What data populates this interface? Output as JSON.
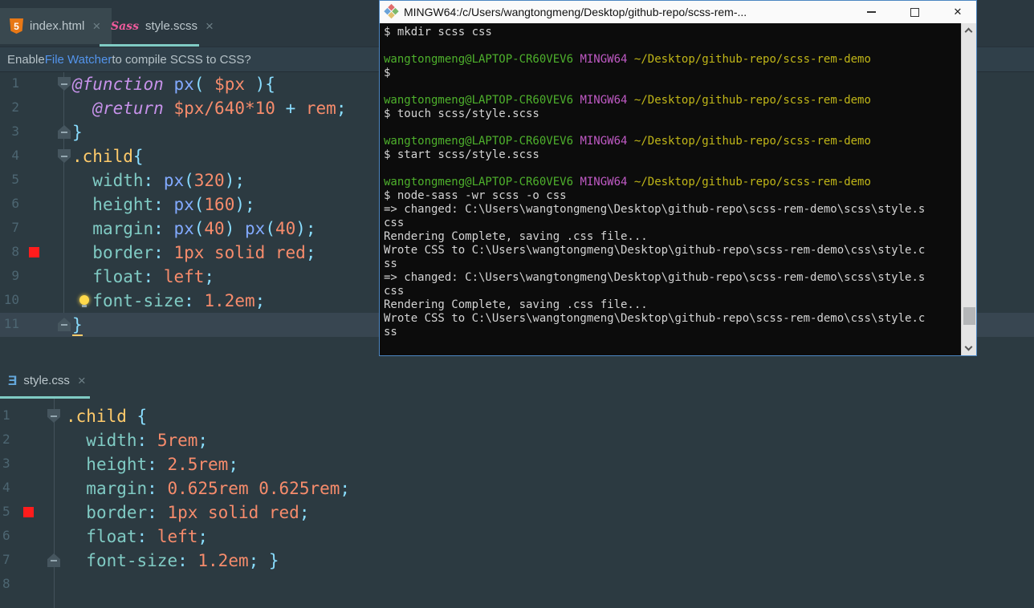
{
  "ui": {
    "tabs_top": [
      {
        "label": "index.html"
      },
      {
        "label": "style.scss"
      }
    ],
    "tab_bottom": {
      "label": "style.css"
    },
    "notification": {
      "prefix": "Enable ",
      "link_label": "File Watcher",
      "suffix": " to compile SCSS to CSS?"
    }
  },
  "icons": {
    "close_tab": "×",
    "close_window": "✕",
    "html5_badge": "5",
    "sass_logo": "Sass",
    "css3_glyph": "Ǝ"
  },
  "palette": {
    "kw": "#c792ea",
    "fn": "#82aaff",
    "punc": "#89ddff",
    "num": "#f78c6c",
    "prop": "#80cbc4",
    "sel": "#ffcb6b",
    "plain": "#b0bec5",
    "swatch_red": "#ff1c1c",
    "accent_teal": "#80cbc4",
    "link_blue": "#5394ec"
  },
  "editor_top": {
    "lines": [
      {
        "n": 1,
        "fold": "down",
        "t": [
          [
            "kw",
            "@function"
          ],
          [
            "plain",
            " "
          ],
          [
            "fn",
            "px"
          ],
          [
            "punc",
            "("
          ],
          [
            "plain",
            " "
          ],
          [
            "num",
            "$px"
          ],
          [
            "plain",
            " "
          ],
          [
            "punc",
            "){"
          ]
        ]
      },
      {
        "n": 2,
        "t": [
          [
            "plain",
            "  "
          ],
          [
            "kw",
            "@return"
          ],
          [
            "plain",
            " "
          ],
          [
            "num",
            "$px/640*10"
          ],
          [
            "plain",
            " "
          ],
          [
            "punc",
            "+"
          ],
          [
            "plain",
            " "
          ],
          [
            "num",
            "rem"
          ],
          [
            "punc",
            ";"
          ]
        ]
      },
      {
        "n": 3,
        "fold": "up",
        "t": [
          [
            "punc",
            "}"
          ]
        ]
      },
      {
        "n": 4,
        "fold": "down",
        "t": [
          [
            "sel",
            ".child"
          ],
          [
            "punc",
            "{"
          ]
        ]
      },
      {
        "n": 5,
        "t": [
          [
            "plain",
            "  "
          ],
          [
            "prop",
            "width"
          ],
          [
            "punc",
            ": "
          ],
          [
            "fn",
            "px"
          ],
          [
            "punc",
            "("
          ],
          [
            "num",
            "320"
          ],
          [
            "punc",
            ");"
          ]
        ]
      },
      {
        "n": 6,
        "t": [
          [
            "plain",
            "  "
          ],
          [
            "prop",
            "height"
          ],
          [
            "punc",
            ": "
          ],
          [
            "fn",
            "px"
          ],
          [
            "punc",
            "("
          ],
          [
            "num",
            "160"
          ],
          [
            "punc",
            ");"
          ]
        ]
      },
      {
        "n": 7,
        "t": [
          [
            "plain",
            "  "
          ],
          [
            "prop",
            "margin"
          ],
          [
            "punc",
            ": "
          ],
          [
            "fn",
            "px"
          ],
          [
            "punc",
            "("
          ],
          [
            "num",
            "40"
          ],
          [
            "punc",
            ")"
          ],
          [
            "plain",
            " "
          ],
          [
            "fn",
            "px"
          ],
          [
            "punc",
            "("
          ],
          [
            "num",
            "40"
          ],
          [
            "punc",
            ");"
          ]
        ]
      },
      {
        "n": 8,
        "swatch": true,
        "t": [
          [
            "plain",
            "  "
          ],
          [
            "prop",
            "border"
          ],
          [
            "punc",
            ": "
          ],
          [
            "num",
            "1px solid red"
          ],
          [
            "punc",
            ";"
          ]
        ]
      },
      {
        "n": 9,
        "t": [
          [
            "plain",
            "  "
          ],
          [
            "prop",
            "float"
          ],
          [
            "punc",
            ": "
          ],
          [
            "num",
            "left"
          ],
          [
            "punc",
            ";"
          ]
        ]
      },
      {
        "n": 10,
        "bulb": true,
        "t": [
          [
            "plain",
            "  "
          ],
          [
            "prop",
            "font-size"
          ],
          [
            "punc",
            ": "
          ],
          [
            "num",
            "1.2em"
          ],
          [
            "punc",
            ";"
          ]
        ]
      },
      {
        "n": 11,
        "fold": "up",
        "hl": true,
        "t": [
          [
            "punc_ul",
            "}"
          ]
        ]
      }
    ]
  },
  "editor_bottom": {
    "lines": [
      {
        "n": 1,
        "fold": "down",
        "t": [
          [
            "sel",
            ".child"
          ],
          [
            "plain",
            " "
          ],
          [
            "punc",
            "{"
          ]
        ]
      },
      {
        "n": 2,
        "t": [
          [
            "plain",
            "  "
          ],
          [
            "prop",
            "width"
          ],
          [
            "punc",
            ": "
          ],
          [
            "num",
            "5rem"
          ],
          [
            "punc",
            ";"
          ]
        ]
      },
      {
        "n": 3,
        "t": [
          [
            "plain",
            "  "
          ],
          [
            "prop",
            "height"
          ],
          [
            "punc",
            ": "
          ],
          [
            "num",
            "2.5rem"
          ],
          [
            "punc",
            ";"
          ]
        ]
      },
      {
        "n": 4,
        "t": [
          [
            "plain",
            "  "
          ],
          [
            "prop",
            "margin"
          ],
          [
            "punc",
            ": "
          ],
          [
            "num",
            "0.625rem 0.625rem"
          ],
          [
            "punc",
            ";"
          ]
        ]
      },
      {
        "n": 5,
        "swatch": true,
        "t": [
          [
            "plain",
            "  "
          ],
          [
            "prop",
            "border"
          ],
          [
            "punc",
            ": "
          ],
          [
            "num",
            "1px solid red"
          ],
          [
            "punc",
            ";"
          ]
        ]
      },
      {
        "n": 6,
        "t": [
          [
            "plain",
            "  "
          ],
          [
            "prop",
            "float"
          ],
          [
            "punc",
            ": "
          ],
          [
            "num",
            "left"
          ],
          [
            "punc",
            ";"
          ]
        ]
      },
      {
        "n": 7,
        "fold": "up",
        "t": [
          [
            "plain",
            "  "
          ],
          [
            "prop",
            "font-size"
          ],
          [
            "punc",
            ": "
          ],
          [
            "num",
            "1.2em"
          ],
          [
            "punc",
            "; }"
          ]
        ]
      },
      {
        "n": 8,
        "t": []
      }
    ]
  },
  "terminal": {
    "title": "MINGW64:/c/Users/wangtongmeng/Desktop/github-repo/scss-rem-...",
    "palette": {
      "green": "#4eb12c",
      "magenta": "#c05ac5",
      "yellow": "#c0b618",
      "plain": "#d4d4d4",
      "bg": "#0c0c0c"
    },
    "lines": [
      [
        [
          "plain",
          "$ mkdir scss css"
        ]
      ],
      [],
      [
        [
          "green",
          "wangtongmeng@LAPTOP-CR60VEV6"
        ],
        [
          "plain",
          " "
        ],
        [
          "magenta",
          "MINGW64"
        ],
        [
          "plain",
          " "
        ],
        [
          "yellow",
          "~/Desktop/github-repo/scss-rem-demo"
        ]
      ],
      [
        [
          "plain",
          "$"
        ]
      ],
      [],
      [
        [
          "green",
          "wangtongmeng@LAPTOP-CR60VEV6"
        ],
        [
          "plain",
          " "
        ],
        [
          "magenta",
          "MINGW64"
        ],
        [
          "plain",
          " "
        ],
        [
          "yellow",
          "~/Desktop/github-repo/scss-rem-demo"
        ]
      ],
      [
        [
          "plain",
          "$ touch scss/style.scss"
        ]
      ],
      [],
      [
        [
          "green",
          "wangtongmeng@LAPTOP-CR60VEV6"
        ],
        [
          "plain",
          " "
        ],
        [
          "magenta",
          "MINGW64"
        ],
        [
          "plain",
          " "
        ],
        [
          "yellow",
          "~/Desktop/github-repo/scss-rem-demo"
        ]
      ],
      [
        [
          "plain",
          "$ start scss/style.scss"
        ]
      ],
      [],
      [
        [
          "green",
          "wangtongmeng@LAPTOP-CR60VEV6"
        ],
        [
          "plain",
          " "
        ],
        [
          "magenta",
          "MINGW64"
        ],
        [
          "plain",
          " "
        ],
        [
          "yellow",
          "~/Desktop/github-repo/scss-rem-demo"
        ]
      ],
      [
        [
          "plain",
          "$ node-sass -wr scss -o css"
        ]
      ],
      [
        [
          "plain",
          "=> changed: C:\\Users\\wangtongmeng\\Desktop\\github-repo\\scss-rem-demo\\scss\\style.s"
        ]
      ],
      [
        [
          "plain",
          "css"
        ]
      ],
      [
        [
          "plain",
          "Rendering Complete, saving .css file..."
        ]
      ],
      [
        [
          "plain",
          "Wrote CSS to C:\\Users\\wangtongmeng\\Desktop\\github-repo\\scss-rem-demo\\css\\style.c"
        ]
      ],
      [
        [
          "plain",
          "ss"
        ]
      ],
      [
        [
          "plain",
          "=> changed: C:\\Users\\wangtongmeng\\Desktop\\github-repo\\scss-rem-demo\\scss\\style.s"
        ]
      ],
      [
        [
          "plain",
          "css"
        ]
      ],
      [
        [
          "plain",
          "Rendering Complete, saving .css file..."
        ]
      ],
      [
        [
          "plain",
          "Wrote CSS to C:\\Users\\wangtongmeng\\Desktop\\github-repo\\scss-rem-demo\\css\\style.c"
        ]
      ],
      [
        [
          "plain",
          "ss"
        ]
      ]
    ]
  }
}
